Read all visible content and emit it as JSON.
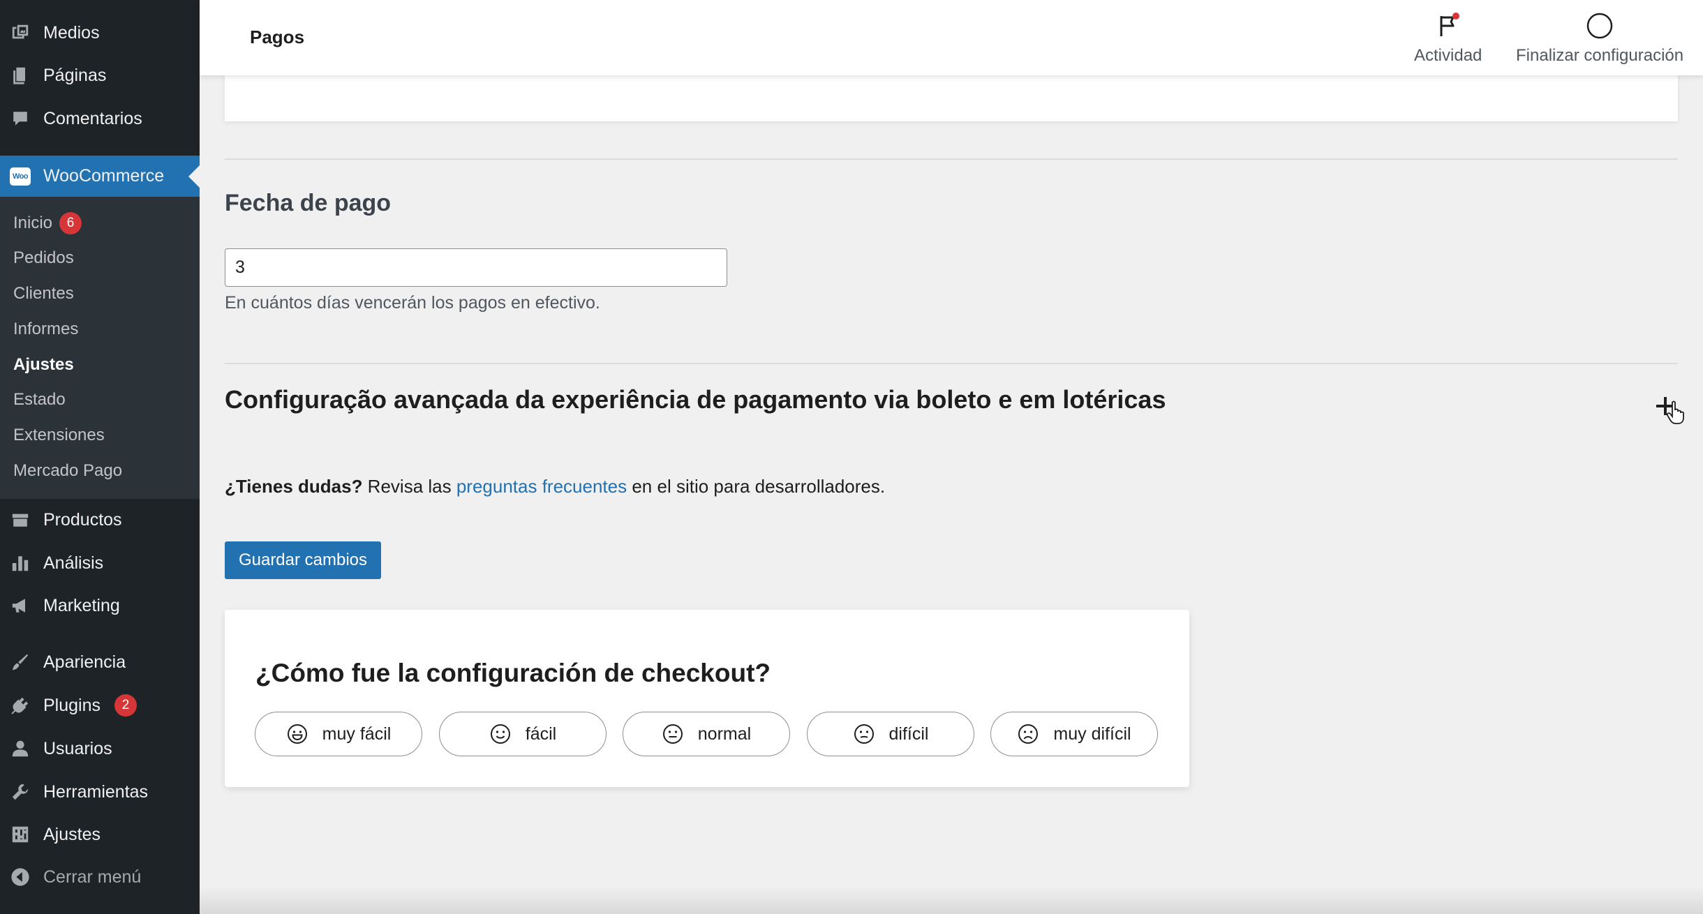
{
  "sidebar": {
    "top_items": [
      {
        "label": "Medios",
        "icon": "media-icon"
      },
      {
        "label": "Páginas",
        "icon": "pages-icon"
      },
      {
        "label": "Comentarios",
        "icon": "comments-icon"
      }
    ],
    "woocommerce": {
      "label": "WooCommerce",
      "icon": "woocommerce-icon",
      "icon_text": "Woo"
    },
    "submenu": [
      {
        "label": "Inicio",
        "badge": "6"
      },
      {
        "label": "Pedidos"
      },
      {
        "label": "Clientes"
      },
      {
        "label": "Informes"
      },
      {
        "label": "Ajustes",
        "current": true
      },
      {
        "label": "Estado"
      },
      {
        "label": "Extensiones"
      },
      {
        "label": "Mercado Pago"
      }
    ],
    "bottom_items": [
      {
        "label": "Productos",
        "icon": "archive-icon"
      },
      {
        "label": "Análisis",
        "icon": "chart-bar-icon"
      },
      {
        "label": "Marketing",
        "icon": "megaphone-icon"
      },
      {
        "label": "Apariencia",
        "icon": "paintbrush-icon"
      },
      {
        "label": "Plugins",
        "icon": "plugin-icon",
        "badge": "2"
      },
      {
        "label": "Usuarios",
        "icon": "user-icon"
      },
      {
        "label": "Herramientas",
        "icon": "wrench-icon"
      },
      {
        "label": "Ajustes",
        "icon": "settings-icon"
      }
    ],
    "collapse_label": "Cerrar menú",
    "colors": {
      "background": "#1d2327",
      "active": "#2271b1",
      "submenu_bg": "#2c3338",
      "badge": "#d63638"
    }
  },
  "header": {
    "title": "Pagos",
    "activity_label": "Actividad",
    "finish_setup_label": "Finalizar configuración"
  },
  "payment_date": {
    "title": "Fecha de pago",
    "value": "3",
    "help": "En cuántos días vencerán los pagos en efectivo."
  },
  "advanced": {
    "title": "Configuração avançada da experiência de pagamento via boleto e em lotéricas"
  },
  "help_line": {
    "question": "¿Tienes dudas?",
    "pre_link": " Revisa las ",
    "link": "preguntas frecuentes",
    "post_link": " en el sitio para desarrolladores."
  },
  "save_label": "Guardar cambios",
  "survey": {
    "question": "¿Cómo fue la configuración de checkout?",
    "options": [
      {
        "label": "muy fácil",
        "icon": "very-happy-face-icon"
      },
      {
        "label": "fácil",
        "icon": "happy-face-icon"
      },
      {
        "label": "normal",
        "icon": "neutral-face-icon"
      },
      {
        "label": "difícil",
        "icon": "sad-face-icon"
      },
      {
        "label": "muy difícil",
        "icon": "very-sad-face-icon"
      }
    ]
  }
}
